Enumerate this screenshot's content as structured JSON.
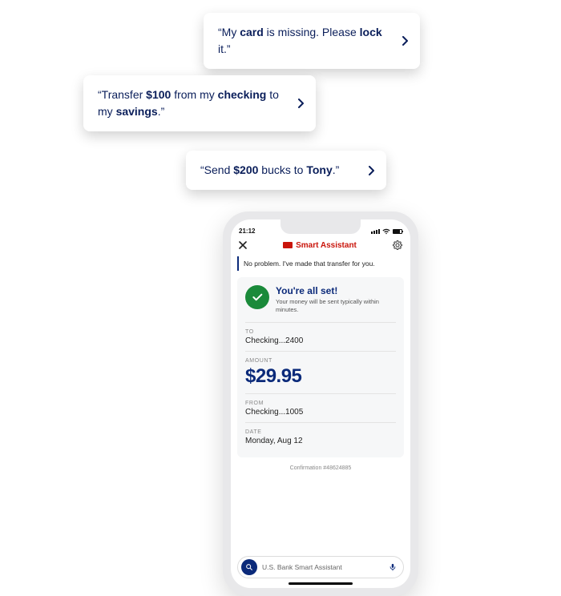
{
  "bubbles": {
    "b1": {
      "pre": "“My ",
      "s1": "card",
      "mid1": " is missing. Please ",
      "s2": "lock",
      "post": " it.”"
    },
    "b2": {
      "pre": "“Transfer ",
      "s1": "$100",
      "mid1": " from my ",
      "s2": "checking",
      "mid2": " to my ",
      "s3": "savings",
      "post": ".”"
    },
    "b3": {
      "pre": "“Send ",
      "s1": "$200",
      "mid1": " bucks to ",
      "s2": "Tony",
      "post": ".”"
    }
  },
  "status": {
    "time": "21:12"
  },
  "app": {
    "title": "Smart Assistant"
  },
  "assistant_msg": "No problem. I've made that transfer for you.",
  "card": {
    "title": "You're all set!",
    "subtitle": "Your money will be sent typically within minutes.",
    "to_label": "TO",
    "to_value": "Checking...2400",
    "amount_label": "AMOUNT",
    "amount_value": "$29.95",
    "from_label": "FROM",
    "from_value": "Checking...1005",
    "date_label": "DATE",
    "date_value": "Monday, Aug 12",
    "confirmation": "Confirmation #48624885"
  },
  "input": {
    "placeholder": "U.S. Bank Smart Assistant"
  }
}
